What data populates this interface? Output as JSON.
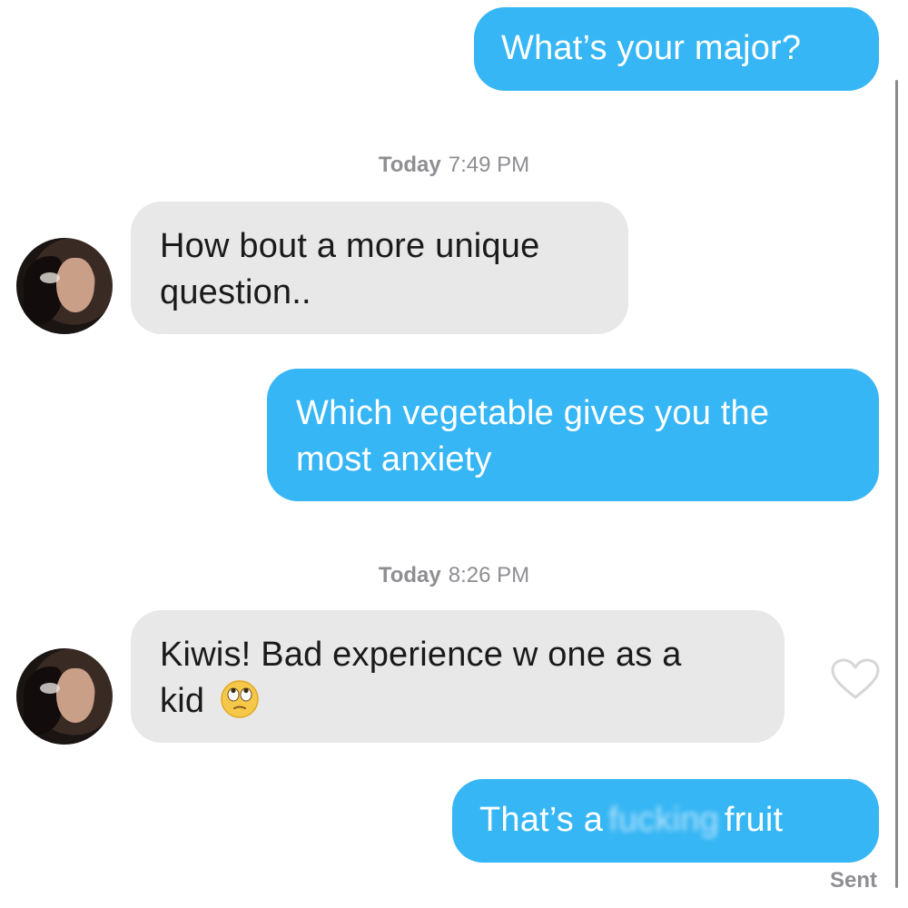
{
  "messages": [
    {
      "type": "sent",
      "text": "What’s your major?"
    },
    {
      "type": "timestamp",
      "day": "Today",
      "time": "7:49 PM"
    },
    {
      "type": "received",
      "text_line1": "How bout a more unique",
      "text_line2": "question.."
    },
    {
      "type": "sent",
      "text_line1": "Which vegetable gives you the",
      "text_line2": "most anxiety"
    },
    {
      "type": "timestamp",
      "day": "Today",
      "time": "8:26 PM"
    },
    {
      "type": "received",
      "text_line1": "Kiwis! Bad experience w one as a",
      "text_line2": "kid",
      "emoji": "rolling-eyes-emoji"
    },
    {
      "type": "sent",
      "text_prefix": "That’s a",
      "text_censored": "fucking",
      "text_suffix": "fruit"
    }
  ],
  "status": "Sent",
  "icons": {
    "like": "heart-outline-icon",
    "avatar": "contact-avatar"
  },
  "colors": {
    "sent_bubble": "#36b6f4",
    "received_bubble": "#e8e8e8",
    "meta_text": "#8e8e93"
  }
}
